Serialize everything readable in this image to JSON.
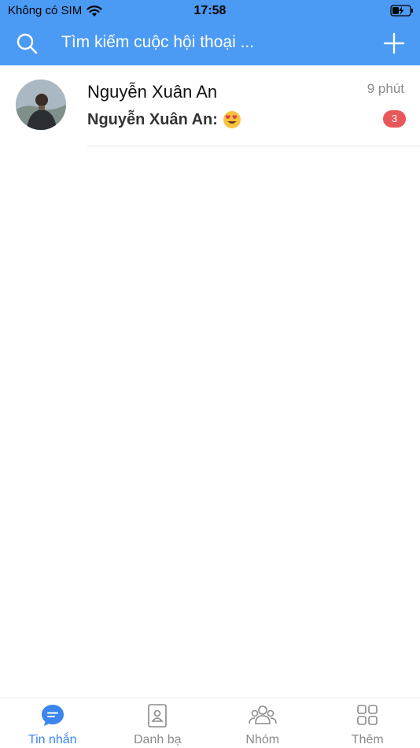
{
  "status_bar": {
    "carrier": "Không có SIM",
    "time": "17:58"
  },
  "header": {
    "search_placeholder": "Tìm kiếm cuộc hội thoại ..."
  },
  "conversations": [
    {
      "name": "Nguyễn Xuân An",
      "time": "9 phút",
      "preview_sender": "Nguyễn Xuân An:",
      "preview_emoji": "heart-eyes-emoji",
      "unread_count": "3"
    }
  ],
  "bottom_nav": {
    "items": [
      {
        "label": "Tin nhắn",
        "icon": "chat-icon",
        "active": true
      },
      {
        "label": "Danh bạ",
        "icon": "contacts-icon",
        "active": false
      },
      {
        "label": "Nhóm",
        "icon": "group-icon",
        "active": false
      },
      {
        "label": "Thêm",
        "icon": "grid-icon",
        "active": false
      }
    ]
  },
  "colors": {
    "primary": "#4b9af3",
    "active_tab": "#3a86ee",
    "badge": "#e9575b"
  }
}
